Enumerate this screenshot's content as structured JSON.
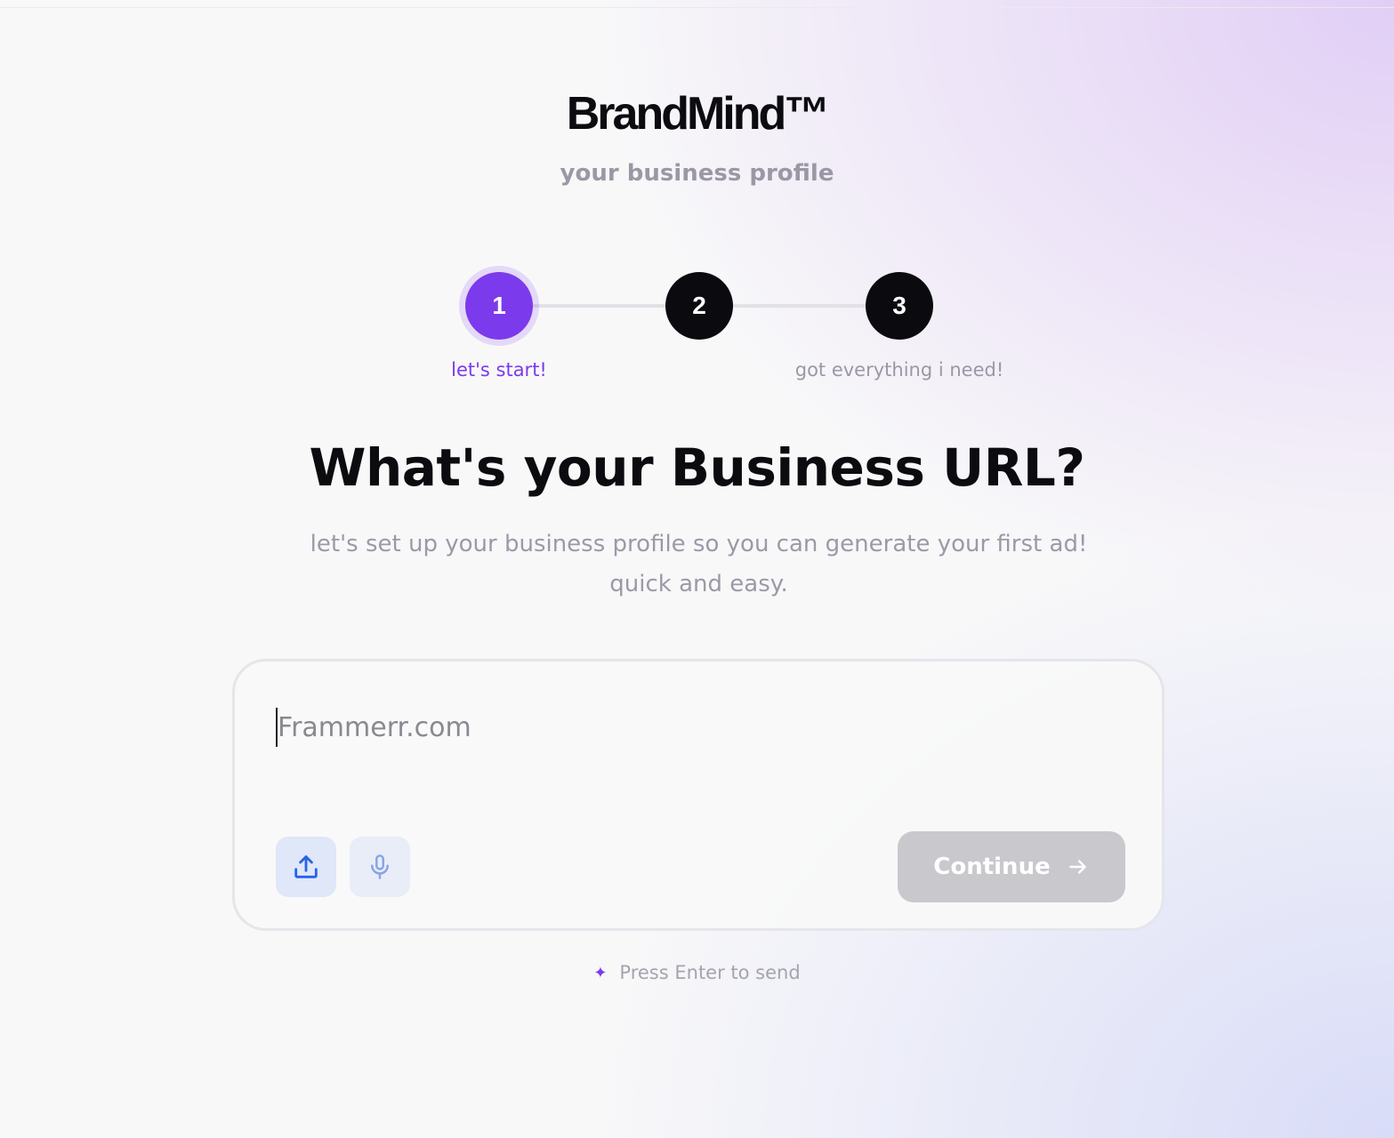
{
  "brand": {
    "name": "BrandMind™",
    "subtitle": "your business profile"
  },
  "stepper": {
    "steps": [
      {
        "number": "1",
        "label": "let's start!",
        "active": true
      },
      {
        "number": "2",
        "label": "",
        "active": false
      },
      {
        "number": "3",
        "label": "got everything i need!",
        "active": false
      }
    ]
  },
  "main": {
    "headline": "What's your Business URL?",
    "description": "let's set up your business profile so you can generate your first ad! quick and easy."
  },
  "input": {
    "placeholder": "Frammerr.com",
    "value": ""
  },
  "actions": {
    "upload_icon": "upload-icon",
    "mic_icon": "microphone-icon",
    "continue_label": "Continue",
    "continue_icon": "arrow-right-icon"
  },
  "hint": {
    "icon": "sparkle-icon",
    "text": "Press Enter to send"
  },
  "colors": {
    "accent": "#7c3aed",
    "step_inactive": "#0b0b0f",
    "button_disabled": "#c8c8cd",
    "upload_icon": "#2563eb",
    "mic_icon": "#8aa4e6"
  }
}
